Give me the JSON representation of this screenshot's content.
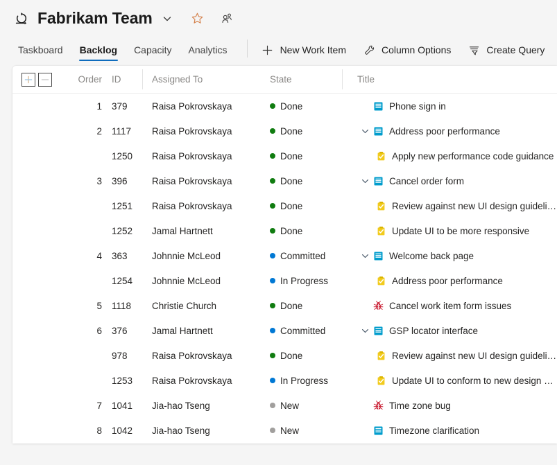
{
  "header": {
    "project_icon": "sprint-loop-icon",
    "title": "Fabrikam Team",
    "chevron_icon": "chevron-down-icon",
    "favorite_icon": "star-icon",
    "members_icon": "team-members-icon"
  },
  "tabs": [
    {
      "label": "Taskboard",
      "active": false
    },
    {
      "label": "Backlog",
      "active": true
    },
    {
      "label": "Capacity",
      "active": false
    },
    {
      "label": "Analytics",
      "active": false
    }
  ],
  "toolbar": [
    {
      "label": "New Work Item",
      "icon": "plus-icon"
    },
    {
      "label": "Column Options",
      "icon": "wrench-icon"
    },
    {
      "label": "Create Query",
      "icon": "filter-icon"
    }
  ],
  "grid": {
    "tools": [
      {
        "name": "expand-all-button",
        "glyph": "+"
      },
      {
        "name": "collapse-all-button",
        "glyph": "−"
      }
    ],
    "columns": [
      {
        "label": "Order",
        "key": "order"
      },
      {
        "label": "ID",
        "key": "id"
      },
      {
        "label": "Assigned To",
        "key": "person"
      },
      {
        "label": "State",
        "key": "state"
      },
      {
        "label": "Title",
        "key": "title"
      }
    ],
    "state_colors": {
      "Done": "#107c10",
      "Committed": "#0078d4",
      "In Progress": "#0078d4",
      "New": "#a19f9d"
    },
    "rows": [
      {
        "order": "1",
        "id": "379",
        "person": "Raisa Pokrovskaya",
        "state": "Done",
        "title": "Phone sign in",
        "type": "backlog-item",
        "level": 0,
        "twisty": "none"
      },
      {
        "order": "2",
        "id": "1117",
        "person": "Raisa Pokrovskaya",
        "state": "Done",
        "title": "Address poor performance",
        "type": "backlog-item",
        "level": 0,
        "twisty": "expanded"
      },
      {
        "order": "",
        "id": "1250",
        "person": "Raisa Pokrovskaya",
        "state": "Done",
        "title": "Apply new performance code guidance",
        "type": "task",
        "level": 1,
        "twisty": "none"
      },
      {
        "order": "3",
        "id": "396",
        "person": "Raisa Pokrovskaya",
        "state": "Done",
        "title": "Cancel order form",
        "type": "backlog-item",
        "level": 0,
        "twisty": "expanded"
      },
      {
        "order": "",
        "id": "1251",
        "person": "Raisa Pokrovskaya",
        "state": "Done",
        "title": "Review against new UI design guidelines",
        "type": "task",
        "level": 1,
        "twisty": "none"
      },
      {
        "order": "",
        "id": "1252",
        "person": "Jamal Hartnett",
        "state": "Done",
        "title": "Update UI to be more responsive",
        "type": "task",
        "level": 1,
        "twisty": "none"
      },
      {
        "order": "4",
        "id": "363",
        "person": "Johnnie McLeod",
        "state": "Committed",
        "title": "Welcome back page",
        "type": "backlog-item",
        "level": 0,
        "twisty": "expanded"
      },
      {
        "order": "",
        "id": "1254",
        "person": "Johnnie McLeod",
        "state": "In Progress",
        "title": "Address poor performance",
        "type": "task",
        "level": 1,
        "twisty": "none"
      },
      {
        "order": "5",
        "id": "1118",
        "person": "Christie Church",
        "state": "Done",
        "title": "Cancel work item form issues",
        "type": "bug",
        "level": 0,
        "twisty": "none"
      },
      {
        "order": "6",
        "id": "376",
        "person": "Jamal Hartnett",
        "state": "Committed",
        "title": "GSP locator interface",
        "type": "backlog-item",
        "level": 0,
        "twisty": "expanded"
      },
      {
        "order": "",
        "id": "978",
        "person": "Raisa Pokrovskaya",
        "state": "Done",
        "title": "Review against new UI design guidelines",
        "type": "task",
        "level": 1,
        "twisty": "none"
      },
      {
        "order": "",
        "id": "1253",
        "person": "Raisa Pokrovskaya",
        "state": "In Progress",
        "title": "Update UI to conform to new design guidelines",
        "type": "task",
        "level": 1,
        "twisty": "none"
      },
      {
        "order": "7",
        "id": "1041",
        "person": "Jia-hao Tseng",
        "state": "New",
        "title": "Time zone bug",
        "type": "bug",
        "level": 0,
        "twisty": "none"
      },
      {
        "order": "8",
        "id": "1042",
        "person": "Jia-hao Tseng",
        "state": "New",
        "title": "Timezone clarification",
        "type": "backlog-item",
        "level": 0,
        "twisty": "none"
      }
    ]
  }
}
